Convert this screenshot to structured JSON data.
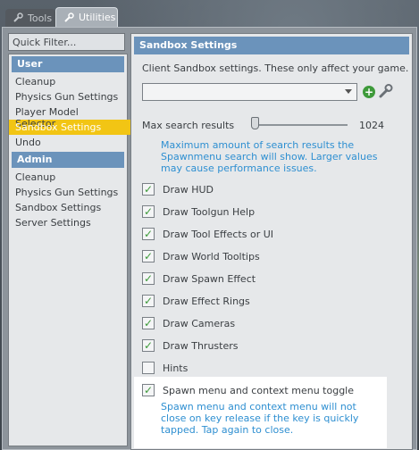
{
  "tabs": [
    {
      "label": "Tools",
      "icon": "wrench-icon"
    },
    {
      "label": "Utilities",
      "icon": "wrench-icon"
    }
  ],
  "filter": {
    "placeholder": "Quick Filter..."
  },
  "left": {
    "categories": [
      {
        "title": "User",
        "items": [
          "Cleanup",
          "Physics Gun Settings",
          "Player Model Selector",
          "Sandbox Settings",
          "Undo"
        ]
      },
      {
        "title": "Admin",
        "items": [
          "Cleanup",
          "Physics Gun Settings",
          "Sandbox Settings",
          "Server Settings"
        ]
      }
    ],
    "selected": "Sandbox Settings"
  },
  "panel": {
    "title": "Sandbox Settings",
    "description": "Client Sandbox settings. These only affect your game.",
    "slider": {
      "label": "Max search results",
      "value": "1024",
      "fraction": 0.0
    },
    "slider_help": "Maximum amount of search results the Spawnmenu search will show. Larger values may cause performance issues.",
    "checkboxes": [
      {
        "label": "Draw HUD",
        "checked": true
      },
      {
        "label": "Draw Toolgun Help",
        "checked": true
      },
      {
        "label": "Draw Tool Effects or UI",
        "checked": true
      },
      {
        "label": "Draw World Tooltips",
        "checked": true
      },
      {
        "label": "Draw Spawn Effect",
        "checked": true
      },
      {
        "label": "Draw Effect Rings",
        "checked": true
      },
      {
        "label": "Draw Cameras",
        "checked": true
      },
      {
        "label": "Draw Thrusters",
        "checked": true
      },
      {
        "label": "Hints",
        "checked": false
      },
      {
        "label": "Spawn menu and context menu toggle",
        "checked": true
      }
    ],
    "spawn_help": "Spawn menu and context menu will not close on key release if the key is quickly tapped. Tap again to close."
  },
  "colors": {
    "header": "#6b93bb",
    "selected": "#f2c514",
    "help": "#2e8fd1",
    "check": "#3e9a3a"
  }
}
